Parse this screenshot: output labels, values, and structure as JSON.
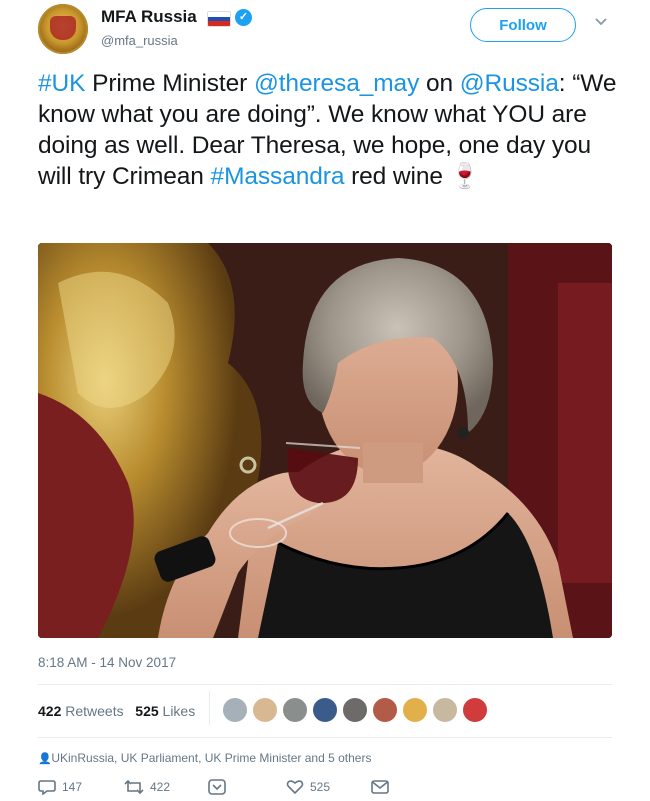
{
  "header": {
    "display_name": "MFA Russia",
    "handle": "@mfa_russia",
    "follow_label": "Follow"
  },
  "tweet": {
    "parts": [
      {
        "text": "#UK",
        "link": true
      },
      {
        "text": " Prime Minister ",
        "link": false
      },
      {
        "text": "@theresa_may",
        "link": true
      },
      {
        "text": " on ",
        "link": false
      },
      {
        "text": "@Russia",
        "link": true
      },
      {
        "text": ": “We know what you are doing”. We know what YOU are doing as well. Dear Theresa, we hope, one day you will try Crimean ",
        "link": false
      },
      {
        "text": "#Massandra",
        "link": true
      },
      {
        "text": " red wine ",
        "link": false
      }
    ],
    "emoji": "🍷"
  },
  "timestamp": "8:18 AM - 14 Nov 2017",
  "stats": {
    "retweets_count": "422",
    "retweets_label": "Retweets",
    "likes_count": "525",
    "likes_label": "Likes"
  },
  "context": {
    "text": "UKinRussia, UK Parliament, UK Prime Minister and 5 others"
  },
  "actions": {
    "replies": "147",
    "retweets": "422",
    "likes": "525"
  },
  "colors": {
    "link": "#1b95e0",
    "follow": "#1da1f2",
    "muted": "#657786"
  }
}
